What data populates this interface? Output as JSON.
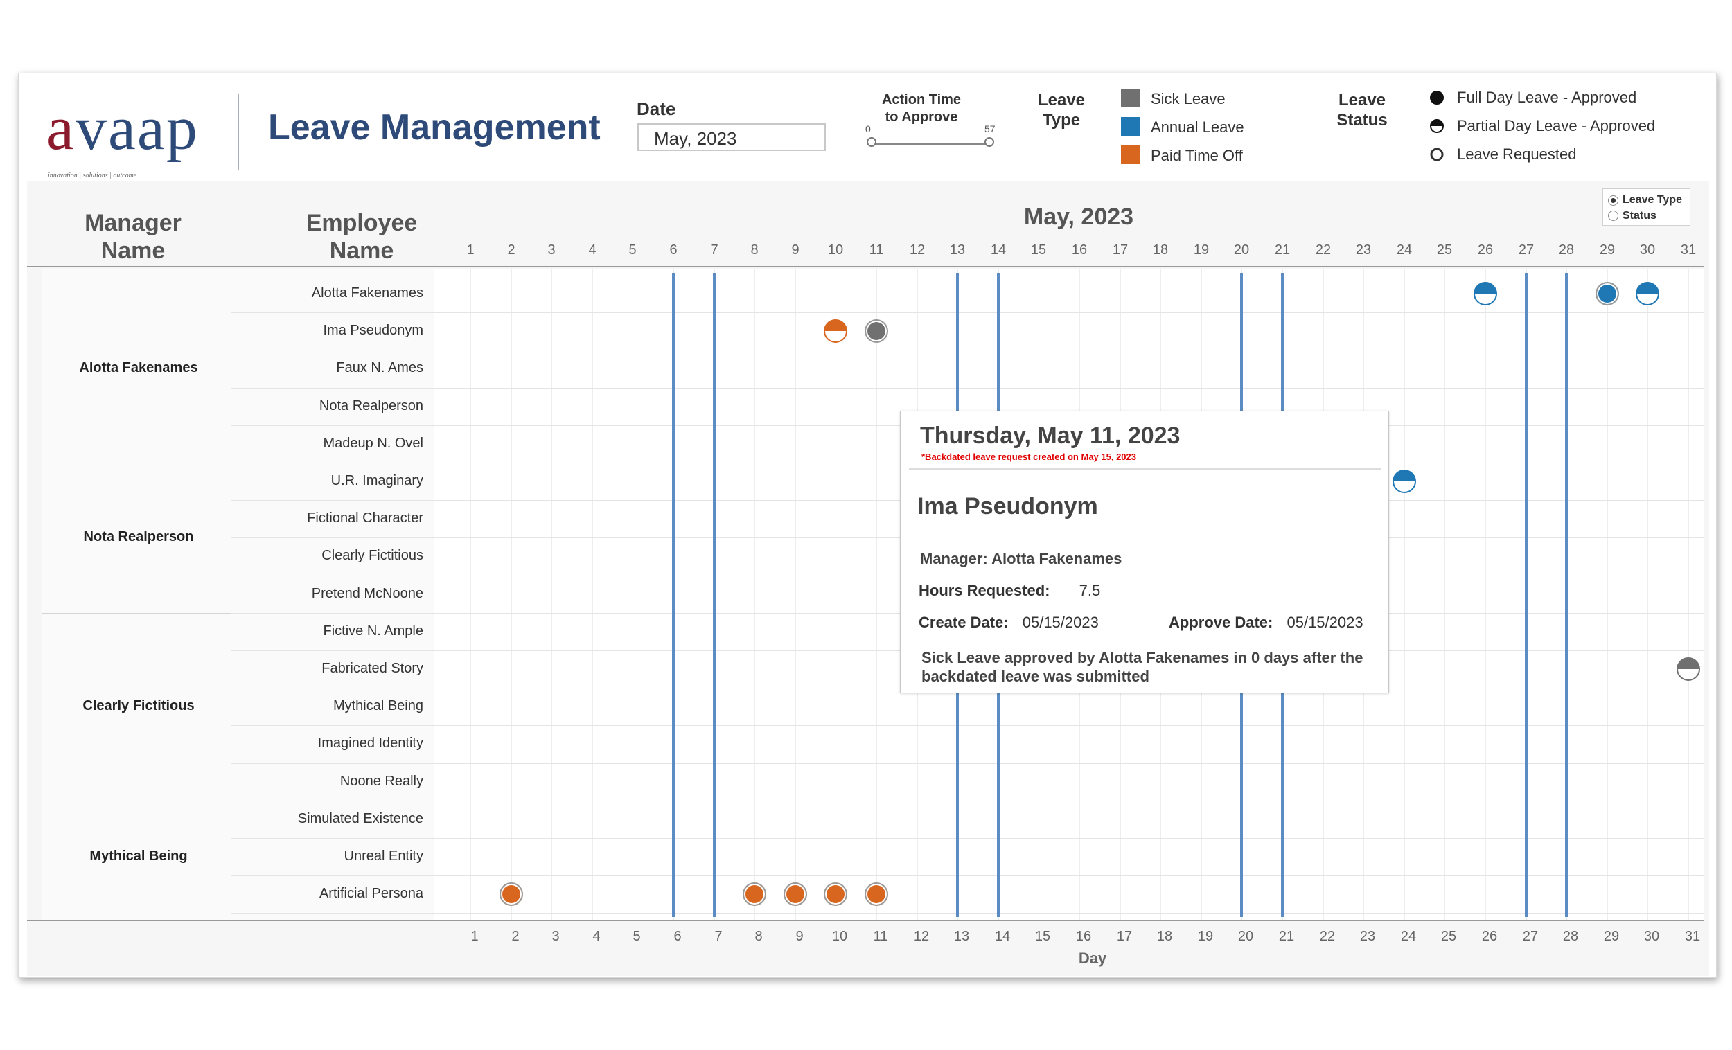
{
  "header": {
    "logo_text": "avaap",
    "logo_tagline": "innovation | solutions | outcome",
    "title": "Leave Management",
    "date_label": "Date",
    "date_value": "May, 2023",
    "action_time_label_1": "Action Time",
    "action_time_label_2": "to Approve",
    "slider_min": "0",
    "slider_max": "57",
    "slider_range": [
      0,
      57
    ],
    "leave_type_title_1": "Leave",
    "leave_type_title_2": "Type",
    "leave_types": [
      {
        "label": "Sick Leave",
        "color": "#707070"
      },
      {
        "label": "Annual Leave",
        "color": "#1f77b4"
      },
      {
        "label": "Paid Time Off",
        "color": "#d9661f"
      }
    ],
    "leave_status_title_1": "Leave",
    "leave_status_title_2": "Status",
    "leave_statuses": [
      {
        "label": "Full Day Leave - Approved",
        "icon": "full-circle-icon"
      },
      {
        "label": "Partial Day Leave - Approved",
        "icon": "half-circle-icon"
      },
      {
        "label": "Leave Requested",
        "icon": "empty-circle-icon"
      }
    ]
  },
  "toggle": {
    "options": [
      "Leave Type",
      "Status"
    ],
    "selected": "Leave Type"
  },
  "chart": {
    "manager_header_1": "Manager",
    "manager_header_2": "Name",
    "employee_header_1": "Employee",
    "employee_header_2": "Name",
    "month_title": "May, 2023",
    "x_axis_title": "Day",
    "days": [
      "1",
      "2",
      "3",
      "4",
      "5",
      "6",
      "7",
      "8",
      "9",
      "10",
      "11",
      "12",
      "13",
      "14",
      "15",
      "16",
      "17",
      "18",
      "19",
      "20",
      "21",
      "22",
      "23",
      "24",
      "25",
      "26",
      "27",
      "28",
      "29",
      "30",
      "31"
    ],
    "weekend_days": [
      6,
      7,
      13,
      14,
      20,
      21,
      27,
      28
    ]
  },
  "employees": [
    "Alotta Fakenames",
    "Ima Pseudonym",
    "Faux N. Ames",
    "Nota Realperson",
    "Madeup N. Ovel",
    "U.R. Imaginary",
    "Fictional Character",
    "Clearly Fictitious",
    "Pretend McNoone",
    "Fictive N. Ample",
    "Fabricated Story",
    "Mythical Being",
    "Imagined Identity",
    "Noone Really",
    "Simulated Existence",
    "Unreal Entity",
    "Artificial Persona"
  ],
  "managers": [
    {
      "name": "Alotta Fakenames",
      "first_row": 0,
      "row_count": 5
    },
    {
      "name": "Nota Realperson",
      "first_row": 5,
      "row_count": 4
    },
    {
      "name": "Clearly Fictitious",
      "first_row": 9,
      "row_count": 5
    },
    {
      "name": "Mythical Being",
      "first_row": 14,
      "row_count": 3
    }
  ],
  "leave_marks": [
    {
      "employee": "Alotta Fakenames",
      "day": 26,
      "type": "Annual Leave",
      "status": "Partial Day Leave - Approved"
    },
    {
      "employee": "Alotta Fakenames",
      "day": 29,
      "type": "Annual Leave",
      "status": "Full Day Leave - Approved"
    },
    {
      "employee": "Alotta Fakenames",
      "day": 30,
      "type": "Annual Leave",
      "status": "Partial Day Leave - Approved"
    },
    {
      "employee": "Ima Pseudonym",
      "day": 10,
      "type": "Paid Time Off",
      "status": "Partial Day Leave - Approved"
    },
    {
      "employee": "Ima Pseudonym",
      "day": 11,
      "type": "Sick Leave",
      "status": "Full Day Leave - Approved"
    },
    {
      "employee": "U.R. Imaginary",
      "day": 24,
      "type": "Annual Leave",
      "status": "Partial Day Leave - Approved"
    },
    {
      "employee": "Fabricated Story",
      "day": 31,
      "type": "Sick Leave",
      "status": "Partial Day Leave - Approved"
    },
    {
      "employee": "Artificial Persona",
      "day": 2,
      "type": "Paid Time Off",
      "status": "Full Day Leave - Approved"
    },
    {
      "employee": "Artificial Persona",
      "day": 8,
      "type": "Paid Time Off",
      "status": "Full Day Leave - Approved"
    },
    {
      "employee": "Artificial Persona",
      "day": 9,
      "type": "Paid Time Off",
      "status": "Full Day Leave - Approved"
    },
    {
      "employee": "Artificial Persona",
      "day": 10,
      "type": "Paid Time Off",
      "status": "Full Day Leave - Approved"
    },
    {
      "employee": "Artificial Persona",
      "day": 11,
      "type": "Paid Time Off",
      "status": "Full Day Leave - Approved"
    }
  ],
  "tooltip": {
    "date": "Thursday, May 11, 2023",
    "note": "*Backdated leave request created on May 15, 2023",
    "employee": "Ima Pseudonym",
    "manager_label": "Manager:",
    "manager_value": "Alotta Fakenames",
    "hours_label": "Hours Requested:",
    "hours_value": "7.5",
    "create_label": "Create Date:",
    "create_value": "05/15/2023",
    "approve_label": "Approve Date:",
    "approve_value": "05/15/2023",
    "description": "Sick Leave approved by Alotta Fakenames in 0 days after the backdated leave was submitted"
  }
}
